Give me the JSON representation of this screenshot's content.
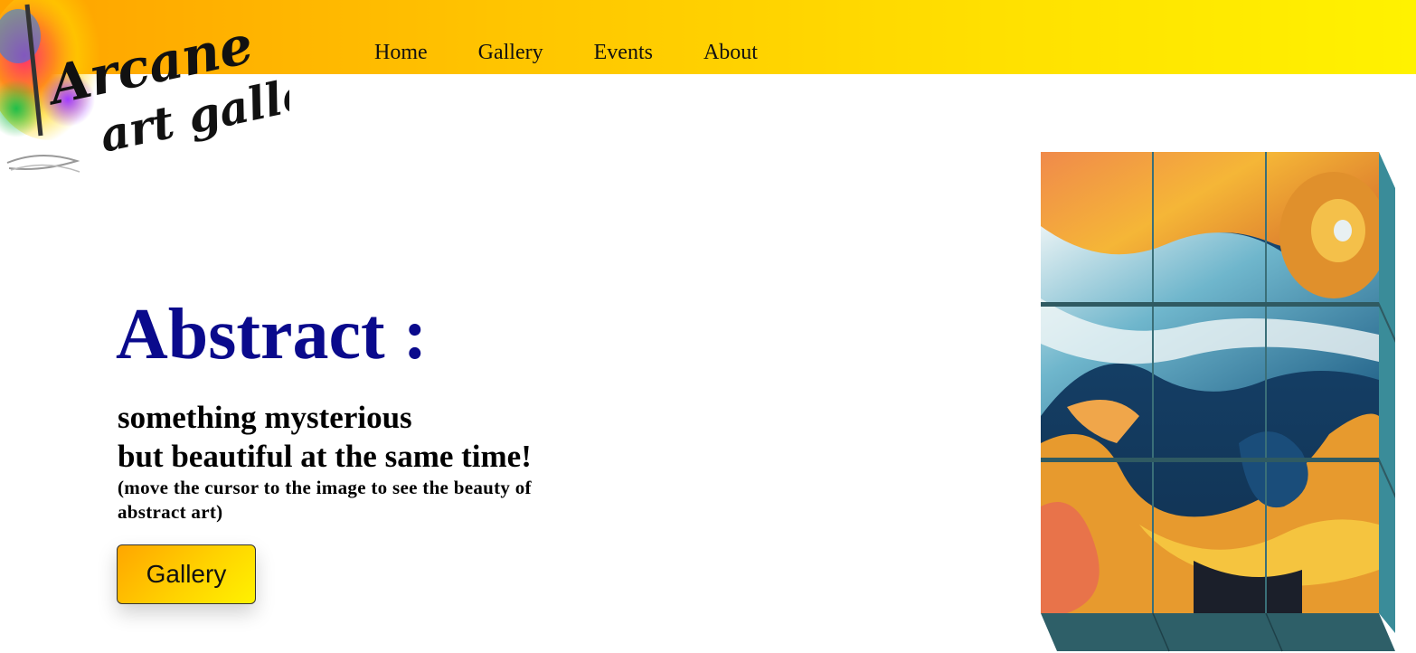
{
  "nav": {
    "items": [
      {
        "label": "Home"
      },
      {
        "label": "Gallery"
      },
      {
        "label": "Events"
      },
      {
        "label": "About"
      }
    ]
  },
  "logo": {
    "text_line1": "Arcane",
    "text_line2": "art gallery"
  },
  "hero": {
    "title": "Abstract :",
    "subtitle_line1": "something mysterious",
    "subtitle_line2": "but beautiful at the same time!",
    "hint": "(move the cursor to the image to see the beauty of abstract art)",
    "button_label": "Gallery"
  },
  "colors": {
    "header_gradient_start": "#ffa200",
    "header_gradient_end": "#fff200",
    "title_color": "#0a0a8c",
    "cube_side": "#3a8c99",
    "cube_bottom": "#2e5f68"
  },
  "artwork": {
    "icon": "abstract-painting-image",
    "grid": "3x3"
  }
}
